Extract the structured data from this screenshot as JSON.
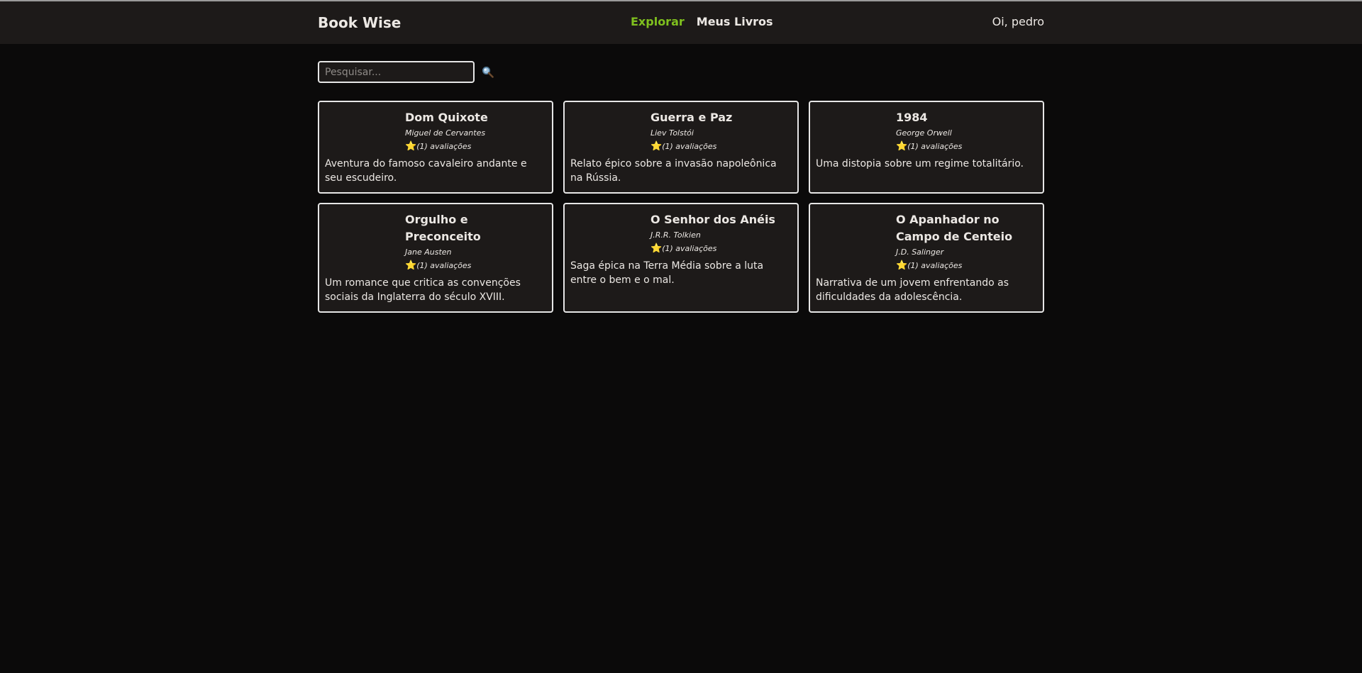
{
  "header": {
    "brand": "Book Wise",
    "nav": [
      {
        "label": "Explorar",
        "active": true
      },
      {
        "label": "Meus Livros",
        "active": false
      }
    ],
    "greeting": "Oi, pedro"
  },
  "search": {
    "placeholder": "Pesquisar...",
    "value": "",
    "icon": "search-icon"
  },
  "colors": {
    "accent": "#7fc01e",
    "background": "#0b0a0a",
    "card": "#1d1a19",
    "star": "#f5c518"
  },
  "books": [
    {
      "title": "Dom Quixote",
      "author": "Miguel de Cervantes",
      "rating_icon": "⭐",
      "reviews": "(1) avaliações",
      "description": "Aventura do famoso cavaleiro andante e seu escudeiro."
    },
    {
      "title": "Guerra e Paz",
      "author": "Liev Tolstói",
      "rating_icon": "⭐",
      "reviews": "(1) avaliações",
      "description": "Relato épico sobre a invasão napoleônica na Rússia."
    },
    {
      "title": "1984",
      "author": "George Orwell",
      "rating_icon": "⭐",
      "reviews": "(1) avaliações",
      "description": "Uma distopia sobre um regime totalitário."
    },
    {
      "title": "Orgulho e Preconceito",
      "author": "Jane Austen",
      "rating_icon": "⭐",
      "reviews": "(1) avaliações",
      "description": "Um romance que critica as convenções sociais da Inglaterra do século XVIII."
    },
    {
      "title": "O Senhor dos Anéis",
      "author": "J.R.R. Tolkien",
      "rating_icon": "⭐",
      "reviews": "(1) avaliações",
      "description": "Saga épica na Terra Média sobre a luta entre o bem e o mal."
    },
    {
      "title": "O Apanhador no Campo de Centeio",
      "author": "J.D. Salinger",
      "rating_icon": "⭐",
      "reviews": "(1) avaliações",
      "description": "Narrativa de um jovem enfrentando as dificuldades da adolescência."
    }
  ]
}
